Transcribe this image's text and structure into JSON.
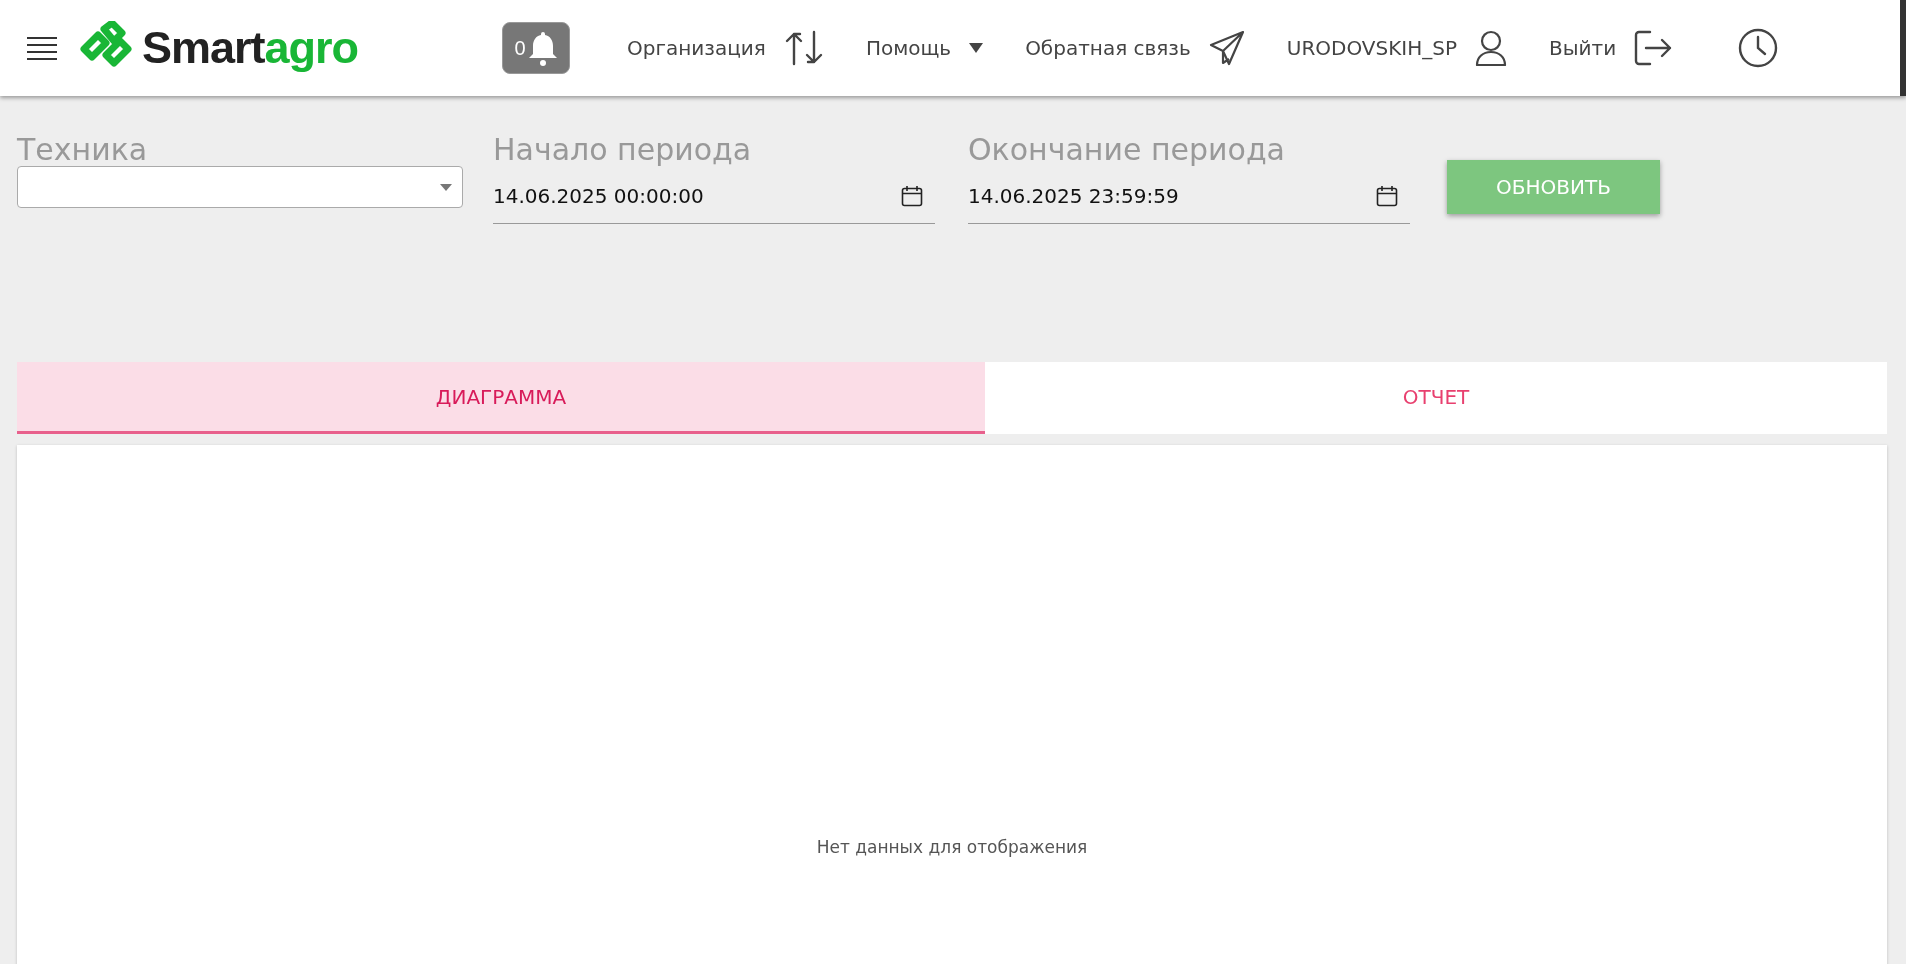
{
  "header": {
    "logo": {
      "part_1": "Smart",
      "part_2": "agro"
    },
    "notifications": {
      "count": "0"
    },
    "nav": [
      {
        "label": "Организация",
        "kind": "swap"
      },
      {
        "label": "Помощь",
        "kind": "dropdown"
      },
      {
        "label": "Обратная связь",
        "kind": "send"
      },
      {
        "label": "URODOVSKIH_SP",
        "kind": "user"
      },
      {
        "label": "Выйти",
        "kind": "logout"
      }
    ]
  },
  "filters": {
    "equipment": {
      "label": "Техника"
    },
    "period_start": {
      "label": "Начало периода",
      "value": "14.06.2025 00:00:00"
    },
    "period_end": {
      "label": "Окончание периода",
      "value": "14.06.2025 23:59:59"
    },
    "refresh_button": "ОБНОВИТЬ"
  },
  "tabs": [
    {
      "label": "ДИАГРАММА",
      "selected": true
    },
    {
      "label": "ОТЧЕТ",
      "selected": false
    }
  ],
  "panel": {
    "empty_message": "Нет данных для отображения"
  }
}
